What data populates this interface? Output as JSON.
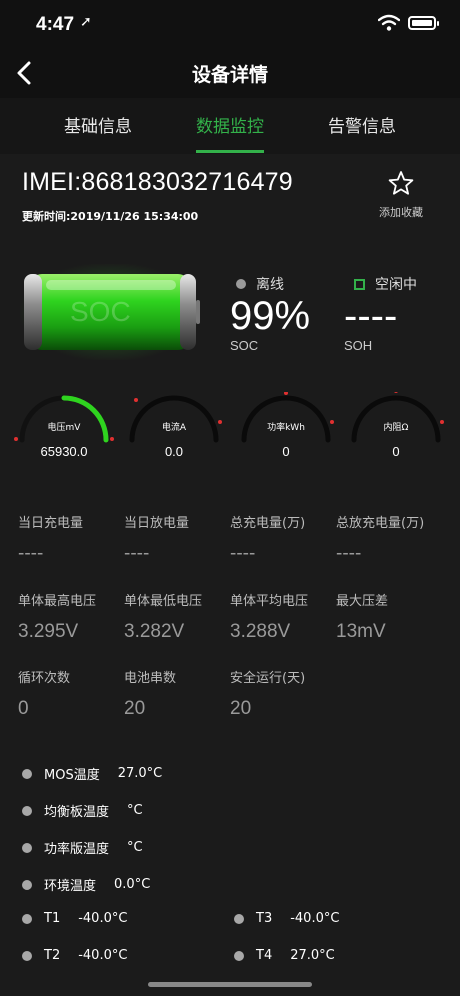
{
  "status": {
    "time": "4:47",
    "location_glyph": "➚"
  },
  "nav": {
    "title": "设备详情"
  },
  "tabs": [
    {
      "label": "基础信息",
      "active": false
    },
    {
      "label": "数据监控",
      "active": true
    },
    {
      "label": "告警信息",
      "active": false
    }
  ],
  "device": {
    "imei": "IMEI:868183032716479",
    "update_time": "更新时间:2019/11/26 15:34:00",
    "favorite_label": "添加收藏"
  },
  "battery": {
    "soc_word": "SOC",
    "online_status": "离线",
    "work_status": "空闲中",
    "soc_value": "99%",
    "soc_label": "SOC",
    "soh_value": "----",
    "soh_label": "SOH"
  },
  "gauges": [
    {
      "label": "电压mV",
      "value": "65930.0",
      "fill_fraction": 0.5
    },
    {
      "label": "电流A",
      "value": "0.0",
      "fill_fraction": 0.0
    },
    {
      "label": "功率kWh",
      "value": "0",
      "fill_fraction": 0.0
    },
    {
      "label": "内阻Ω",
      "value": "0",
      "fill_fraction": 0.0
    }
  ],
  "stats": [
    [
      {
        "title": "当日充电量",
        "value": "----"
      },
      {
        "title": "当日放电量",
        "value": "----"
      },
      {
        "title": "总充电量(万)",
        "value": "----"
      },
      {
        "title": "总放充电量(万)",
        "value": "----"
      }
    ],
    [
      {
        "title": "单体最高电压",
        "value": "3.295V"
      },
      {
        "title": "单体最低电压",
        "value": "3.282V"
      },
      {
        "title": "单体平均电压",
        "value": "3.288V"
      },
      {
        "title": "最大压差",
        "value": "13mV"
      }
    ],
    [
      {
        "title": "循环次数",
        "value": "0"
      },
      {
        "title": "电池串数",
        "value": "20"
      },
      {
        "title": "安全运行(天)",
        "value": "20"
      }
    ]
  ],
  "temps": [
    {
      "label": "MOS温度",
      "value": "27.0°C"
    },
    {
      "label": "均衡板温度",
      "value": "°C"
    },
    {
      "label": "功率版温度",
      "value": "°C"
    },
    {
      "label": "环境温度",
      "value": "0.0°C"
    }
  ],
  "sensors": [
    {
      "label": "T1",
      "value": "-40.0°C"
    },
    {
      "label": "T3",
      "value": "-40.0°C"
    },
    {
      "label": "T2",
      "value": "-40.0°C"
    },
    {
      "label": "T4",
      "value": "27.0°C"
    }
  ],
  "colors": {
    "accent": "#33b14a",
    "background": "#1b1b1b",
    "header": "#111111"
  }
}
